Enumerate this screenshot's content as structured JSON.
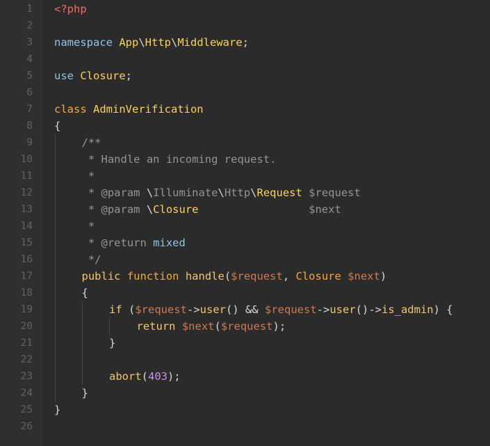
{
  "file": {
    "lines": [
      {
        "n": "1",
        "indent": 0,
        "tokens": [
          {
            "c": "tag",
            "t": "<?php"
          }
        ]
      },
      {
        "n": "2",
        "indent": 0,
        "tokens": []
      },
      {
        "n": "3",
        "indent": 0,
        "tokens": [
          {
            "c": "ns",
            "t": "namespace "
          },
          {
            "c": "cls",
            "t": "App"
          },
          {
            "c": "bs",
            "t": "\\"
          },
          {
            "c": "cls",
            "t": "Http"
          },
          {
            "c": "bs",
            "t": "\\"
          },
          {
            "c": "cls",
            "t": "Middleware"
          },
          {
            "c": "p",
            "t": ";"
          }
        ]
      },
      {
        "n": "4",
        "indent": 0,
        "tokens": []
      },
      {
        "n": "5",
        "indent": 0,
        "tokens": [
          {
            "c": "ns",
            "t": "use "
          },
          {
            "c": "cls",
            "t": "Closure"
          },
          {
            "c": "p",
            "t": ";"
          }
        ]
      },
      {
        "n": "6",
        "indent": 0,
        "tokens": []
      },
      {
        "n": "7",
        "indent": 0,
        "tokens": [
          {
            "c": "kw",
            "t": "class "
          },
          {
            "c": "cls",
            "t": "AdminVerification"
          }
        ]
      },
      {
        "n": "8",
        "indent": 0,
        "tokens": [
          {
            "c": "p",
            "t": "{"
          }
        ]
      },
      {
        "n": "9",
        "indent": 1,
        "tokens": [
          {
            "c": "com",
            "t": "/**"
          }
        ]
      },
      {
        "n": "10",
        "indent": 1,
        "tokens": [
          {
            "c": "com",
            "t": " * Handle an incoming request."
          }
        ]
      },
      {
        "n": "11",
        "indent": 1,
        "tokens": [
          {
            "c": "com",
            "t": " *"
          }
        ]
      },
      {
        "n": "12",
        "indent": 1,
        "tokens": [
          {
            "c": "com",
            "t": " * @param "
          },
          {
            "c": "p",
            "t": "\\"
          },
          {
            "c": "com",
            "t": "Illuminate"
          },
          {
            "c": "p",
            "t": "\\"
          },
          {
            "c": "com",
            "t": "Http"
          },
          {
            "c": "p",
            "t": "\\"
          },
          {
            "c": "cls",
            "t": "Request"
          },
          {
            "c": "com",
            "t": " $request"
          }
        ]
      },
      {
        "n": "13",
        "indent": 1,
        "tokens": [
          {
            "c": "com",
            "t": " * @param "
          },
          {
            "c": "p",
            "t": "\\"
          },
          {
            "c": "cls",
            "t": "Closure"
          },
          {
            "c": "com",
            "t": "                 $next"
          }
        ]
      },
      {
        "n": "14",
        "indent": 1,
        "tokens": [
          {
            "c": "com",
            "t": " *"
          }
        ]
      },
      {
        "n": "15",
        "indent": 1,
        "tokens": [
          {
            "c": "com",
            "t": " * @return "
          },
          {
            "c": "ns",
            "t": "mixed"
          }
        ]
      },
      {
        "n": "16",
        "indent": 1,
        "tokens": [
          {
            "c": "com",
            "t": " */"
          }
        ]
      },
      {
        "n": "17",
        "indent": 1,
        "tokens": [
          {
            "c": "kw2",
            "t": "public "
          },
          {
            "c": "kw",
            "t": "function "
          },
          {
            "c": "fn",
            "t": "handle"
          },
          {
            "c": "p",
            "t": "("
          },
          {
            "c": "var",
            "t": "$request"
          },
          {
            "c": "p",
            "t": ", "
          },
          {
            "c": "kw",
            "t": "Closure "
          },
          {
            "c": "var",
            "t": "$next"
          },
          {
            "c": "p",
            "t": ")"
          }
        ]
      },
      {
        "n": "18",
        "indent": 1,
        "tokens": [
          {
            "c": "p",
            "t": "{"
          }
        ]
      },
      {
        "n": "19",
        "indent": 2,
        "tokens": [
          {
            "c": "kw2",
            "t": "if "
          },
          {
            "c": "p",
            "t": "("
          },
          {
            "c": "var",
            "t": "$request"
          },
          {
            "c": "p",
            "t": "->"
          },
          {
            "c": "fn",
            "t": "user"
          },
          {
            "c": "p",
            "t": "() && "
          },
          {
            "c": "var",
            "t": "$request"
          },
          {
            "c": "p",
            "t": "->"
          },
          {
            "c": "fn",
            "t": "user"
          },
          {
            "c": "p",
            "t": "()->"
          },
          {
            "c": "fn",
            "t": "is_admin"
          },
          {
            "c": "p",
            "t": ") {"
          }
        ]
      },
      {
        "n": "20",
        "indent": 3,
        "tokens": [
          {
            "c": "kw2",
            "t": "return "
          },
          {
            "c": "var",
            "t": "$next"
          },
          {
            "c": "p",
            "t": "("
          },
          {
            "c": "var",
            "t": "$request"
          },
          {
            "c": "p",
            "t": ");"
          }
        ]
      },
      {
        "n": "21",
        "indent": 2,
        "tokens": [
          {
            "c": "p",
            "t": "}"
          }
        ]
      },
      {
        "n": "22",
        "indent": 0,
        "tokens": []
      },
      {
        "n": "23",
        "indent": 2,
        "tokens": [
          {
            "c": "fn",
            "t": "abort"
          },
          {
            "c": "p",
            "t": "("
          },
          {
            "c": "num",
            "t": "403"
          },
          {
            "c": "p",
            "t": ");"
          }
        ]
      },
      {
        "n": "24",
        "indent": 1,
        "tokens": [
          {
            "c": "p",
            "t": "}"
          }
        ]
      },
      {
        "n": "25",
        "indent": 0,
        "tokens": [
          {
            "c": "p",
            "t": "}"
          }
        ]
      },
      {
        "n": "26",
        "indent": 0,
        "tokens": []
      }
    ]
  },
  "colors": {
    "background": "#2b2b2b",
    "gutter": "#2f2f2f",
    "line_number": "#5f6366"
  }
}
